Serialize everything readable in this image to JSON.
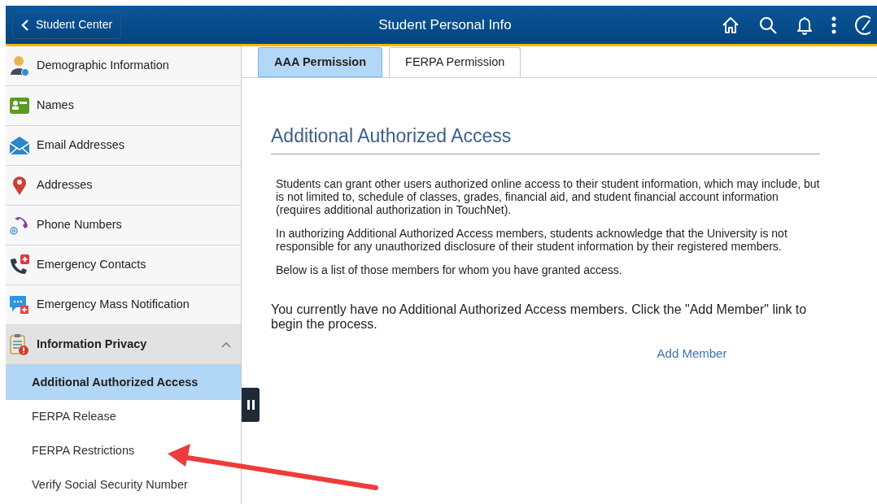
{
  "header": {
    "back_button": "Student Center",
    "title": "Student Personal Info"
  },
  "sidebar": {
    "items": [
      {
        "label": "Demographic Information"
      },
      {
        "label": "Names"
      },
      {
        "label": "Email Addresses"
      },
      {
        "label": "Addresses"
      },
      {
        "label": "Phone Numbers"
      },
      {
        "label": "Emergency Contacts"
      },
      {
        "label": "Emergency Mass Notification"
      },
      {
        "label": "Information Privacy",
        "expanded": true,
        "children": [
          {
            "label": "Additional Authorized Access",
            "selected": true
          },
          {
            "label": "FERPA Release",
            "selected": false
          },
          {
            "label": "FERPA Restrictions",
            "selected": false
          },
          {
            "label": "Verify Social Security Number",
            "selected": false
          }
        ]
      }
    ]
  },
  "tabs": [
    {
      "label": "AAA Permission",
      "selected": true
    },
    {
      "label": "FERPA Permission",
      "selected": false
    }
  ],
  "content": {
    "heading": "Additional Authorized Access",
    "paragraphs": [
      "Students can grant other users authorized online access to their student information, which may include, but is not limited to, schedule of classes, grades, financial aid, and student financial account information (requires additional authorization in TouchNet).",
      "In authorizing Additional Authorized Access members, students acknowledge that the University is not responsible for any unauthorized disclosure of their student information by their registered members.",
      "Below is a list of those members for whom you have granted access."
    ],
    "message": "You currently have no Additional Authorized Access members. Click the \"Add Member\" link to begin the process.",
    "link": "Add Member"
  }
}
